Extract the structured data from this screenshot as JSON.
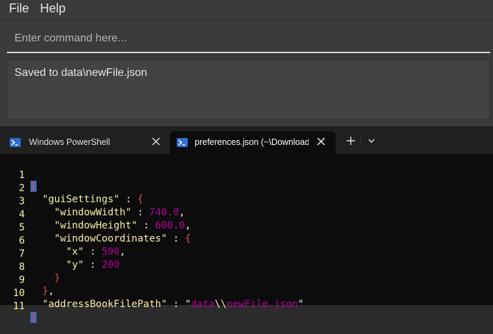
{
  "menu": {
    "file": "File",
    "help": "Help"
  },
  "command": {
    "placeholder": "Enter command here...",
    "value": ""
  },
  "result": {
    "text": "Saved to data\\newFile.json"
  },
  "terminal": {
    "tabs": [
      {
        "title": "Windows PowerShell",
        "icon": "powershell-icon",
        "active": false
      },
      {
        "title": "preferences.json (~\\Downloads",
        "icon": "powershell-icon",
        "active": true
      }
    ],
    "new_tab_label": "+",
    "line_numbers": [
      "1",
      "2",
      "3",
      "4",
      "5",
      "6",
      "7",
      "8",
      "9",
      "10",
      "11"
    ],
    "code": {
      "l1_brace": "{",
      "gui_key": "\"guiSettings\"",
      "colon": " : ",
      "open_brace": "{",
      "width_key": "\"windowWidth\"",
      "width_val": "740.0",
      "height_key": "\"windowHeight\"",
      "height_val": "600.0",
      "coords_key": "\"windowCoordinates\"",
      "x_key": "\"x\"",
      "x_val": "590",
      "y_key": "\"y\"",
      "y_val": "200",
      "close_brace": "}",
      "close_brace_comma": "},",
      "path_key": "\"addressBookFilePath\"",
      "path_val_q1": "\"",
      "path_val_a": "data",
      "path_val_esc": "\\\\",
      "path_val_b": "newFile.json",
      "path_val_q2": "\"",
      "comma": ","
    },
    "colors": {
      "key": "#f9f1a5",
      "value": "#b4009e",
      "brace": "#e74856",
      "cursor": "#3a6db6"
    }
  }
}
